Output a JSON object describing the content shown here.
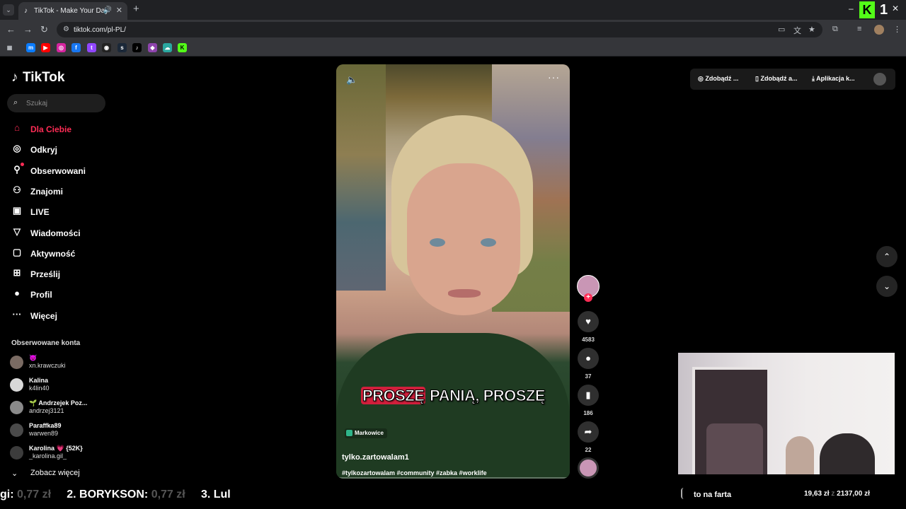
{
  "browser": {
    "tab_title": "TikTok - Make Your Day",
    "url": "tiktok.com/pl-PL/"
  },
  "sidebar": {
    "logo": "TikTok",
    "search_placeholder": "Szukaj",
    "nav": [
      {
        "label": "Dla Ciebie",
        "icon": "home-icon"
      },
      {
        "label": "Odkryj",
        "icon": "compass-icon"
      },
      {
        "label": "Obserwowani",
        "icon": "following-icon"
      },
      {
        "label": "Znajomi",
        "icon": "friends-icon"
      },
      {
        "label": "LIVE",
        "icon": "live-icon"
      },
      {
        "label": "Wiadomości",
        "icon": "messages-icon"
      },
      {
        "label": "Aktywność",
        "icon": "activity-icon"
      },
      {
        "label": "Prześlij",
        "icon": "upload-icon"
      },
      {
        "label": "Profil",
        "icon": "profile-icon"
      },
      {
        "label": "Więcej",
        "icon": "more-icon"
      }
    ],
    "following_title": "Obserwowane konta",
    "accounts": [
      {
        "name": "😈",
        "handle": "xn.krawczuki"
      },
      {
        "name": "Kalina",
        "handle": "k4lin40"
      },
      {
        "name": "🌱 Andrzejek Poz...",
        "handle": "andrzej3121"
      },
      {
        "name": "Paraffka89",
        "handle": "warwen89"
      },
      {
        "name": "Karolina 💗 {52K}",
        "handle": "_karolina.gil_"
      }
    ],
    "see_more": "Zobacz więcej"
  },
  "video": {
    "caption_highlight": "PROSZĘ",
    "caption_rest": " PANIĄ, PROSZĘ",
    "location": "Markowice",
    "author": "tylko.zartowalam1",
    "tags": "#tylkozartowalam #community #zabka #worklife"
  },
  "actions": {
    "likes": "4583",
    "comments": "37",
    "saves": "186",
    "shares": "22"
  },
  "top_right": {
    "item1": "Zdobądź ...",
    "item2": "Zdobądź a...",
    "item3": "Aplikacja k..."
  },
  "overlay": {
    "ticker_prefix": "gi: ",
    "ticker_prefix_amount": "0,77 zł",
    "ticker_2": "2. BORYKSON: ",
    "ticker_2_amount": "0,77 zł",
    "ticker_3": "3. Lul",
    "goal_label": "to na farta",
    "goal_current": "19,63 zł",
    "goal_sep": " z ",
    "goal_target": "2137,00 zł"
  }
}
